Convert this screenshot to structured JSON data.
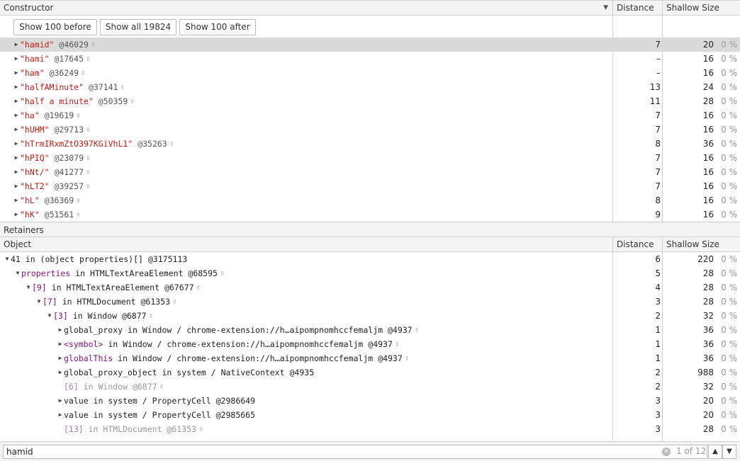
{
  "constructors_header": {
    "col1": "Constructor",
    "col2": "Distance",
    "col3": "Shallow Size",
    "sort_arrow": "▼"
  },
  "buttons": {
    "before": "Show 100 before",
    "all": "Show all 19824",
    "after": "Show 100 after"
  },
  "constructor_rows": [
    {
      "name": "\"hamid\"",
      "id": "@46029",
      "dist": "7",
      "size": "20",
      "pct": "0 %",
      "selected": true
    },
    {
      "name": "\"hami\"",
      "id": "@17645",
      "dist": "–",
      "size": "16",
      "pct": "0 %"
    },
    {
      "name": "\"ham\"",
      "id": "@36249",
      "dist": "–",
      "size": "16",
      "pct": "0 %"
    },
    {
      "name": "\"halfAMinute\"",
      "id": "@37141",
      "dist": "13",
      "size": "24",
      "pct": "0 %"
    },
    {
      "name": "\"half a minute\"",
      "id": "@50359",
      "dist": "11",
      "size": "28",
      "pct": "0 %"
    },
    {
      "name": "\"ha\"",
      "id": "@19619",
      "dist": "7",
      "size": "16",
      "pct": "0 %"
    },
    {
      "name": "\"hUHM\"",
      "id": "@29713",
      "dist": "7",
      "size": "16",
      "pct": "0 %"
    },
    {
      "name": "\"hTrmIRxmZtO397KGiVhL1\"",
      "id": "@35263",
      "dist": "8",
      "size": "36",
      "pct": "0 %"
    },
    {
      "name": "\"hPIQ\"",
      "id": "@23079",
      "dist": "7",
      "size": "16",
      "pct": "0 %"
    },
    {
      "name": "\"hNt/\"",
      "id": "@41277",
      "dist": "7",
      "size": "16",
      "pct": "0 %"
    },
    {
      "name": "\"hLT2\"",
      "id": "@39257",
      "dist": "7",
      "size": "16",
      "pct": "0 %"
    },
    {
      "name": "\"hL\"",
      "id": "@36369",
      "dist": "8",
      "size": "16",
      "pct": "0 %"
    },
    {
      "name": "\"hK\"",
      "id": "@51561",
      "dist": "9",
      "size": "16",
      "pct": "0 %"
    }
  ],
  "retainers_title": "Retainers",
  "retainers_header": {
    "col1": "Object",
    "col2": "Distance",
    "col3": "Shallow Size"
  },
  "retainer_rows": [
    {
      "depth": 0,
      "tri": "▼",
      "key": "41",
      "keytype": "plain",
      "rest": " in (object properties)[] @3175113",
      "glyph": false,
      "dist": "6",
      "size": "220",
      "pct": "0 %"
    },
    {
      "depth": 1,
      "tri": "▼",
      "key": "properties",
      "keytype": "prop",
      "rest": " in HTMLTextAreaElement @68595",
      "glyph": true,
      "dist": "5",
      "size": "28",
      "pct": "0 %"
    },
    {
      "depth": 2,
      "tri": "▼",
      "key": "[9]",
      "keytype": "prop",
      "rest": " in HTMLTextAreaElement @67677",
      "glyph": true,
      "dist": "4",
      "size": "28",
      "pct": "0 %"
    },
    {
      "depth": 3,
      "tri": "▼",
      "key": "[7]",
      "keytype": "prop",
      "rest": " in HTMLDocument @61353",
      "glyph": true,
      "dist": "3",
      "size": "28",
      "pct": "0 %"
    },
    {
      "depth": 4,
      "tri": "▼",
      "key": "[3]",
      "keytype": "prop",
      "rest": " in Window @6877",
      "glyph": true,
      "dist": "2",
      "size": "32",
      "pct": "0 %"
    },
    {
      "depth": 5,
      "tri": "▶",
      "key": "global_proxy",
      "keytype": "plain",
      "rest": " in Window / chrome-extension://h…aipompnomhccfemaljm @4937",
      "glyph": true,
      "dist": "1",
      "size": "36",
      "pct": "0 %"
    },
    {
      "depth": 5,
      "tri": "▶",
      "key": "<symbol>",
      "keytype": "prop",
      "rest": " in Window / chrome-extension://h…aipompnomhccfemaljm @4937",
      "glyph": true,
      "dist": "1",
      "size": "36",
      "pct": "0 %"
    },
    {
      "depth": 5,
      "tri": "▶",
      "key": "globalThis",
      "keytype": "prop",
      "rest": " in Window / chrome-extension://h…aipompnomhccfemaljm @4937",
      "glyph": true,
      "dist": "1",
      "size": "36",
      "pct": "0 %"
    },
    {
      "depth": 5,
      "tri": "▶",
      "key": "global_proxy_object",
      "keytype": "plain",
      "rest": " in system / NativeContext @4935",
      "glyph": false,
      "dist": "2",
      "size": "988",
      "pct": "0 %"
    },
    {
      "depth": 5,
      "tri": "",
      "key": "[6]",
      "keytype": "dimprop",
      "rest": " in Window @6877",
      "glyph": true,
      "dimmed": true,
      "dist": "2",
      "size": "32",
      "pct": "0 %"
    },
    {
      "depth": 5,
      "tri": "▶",
      "key": "value",
      "keytype": "plain",
      "rest": " in system / PropertyCell @2986649",
      "glyph": false,
      "dist": "3",
      "size": "20",
      "pct": "0 %"
    },
    {
      "depth": 5,
      "tri": "▶",
      "key": "value",
      "keytype": "plain",
      "rest": " in system / PropertyCell @2985665",
      "glyph": false,
      "dist": "3",
      "size": "20",
      "pct": "0 %"
    },
    {
      "depth": 5,
      "tri": "",
      "key": "[13]",
      "keytype": "dimprop",
      "rest": " in HTMLDocument @61353",
      "glyph": true,
      "dimmed": true,
      "dist": "3",
      "size": "28",
      "pct": "0 %"
    }
  ],
  "search": {
    "value": "hamid",
    "match": "1 of 12",
    "up": "▲",
    "down": "▼",
    "clear": "✕"
  },
  "glyph_char": "▯"
}
